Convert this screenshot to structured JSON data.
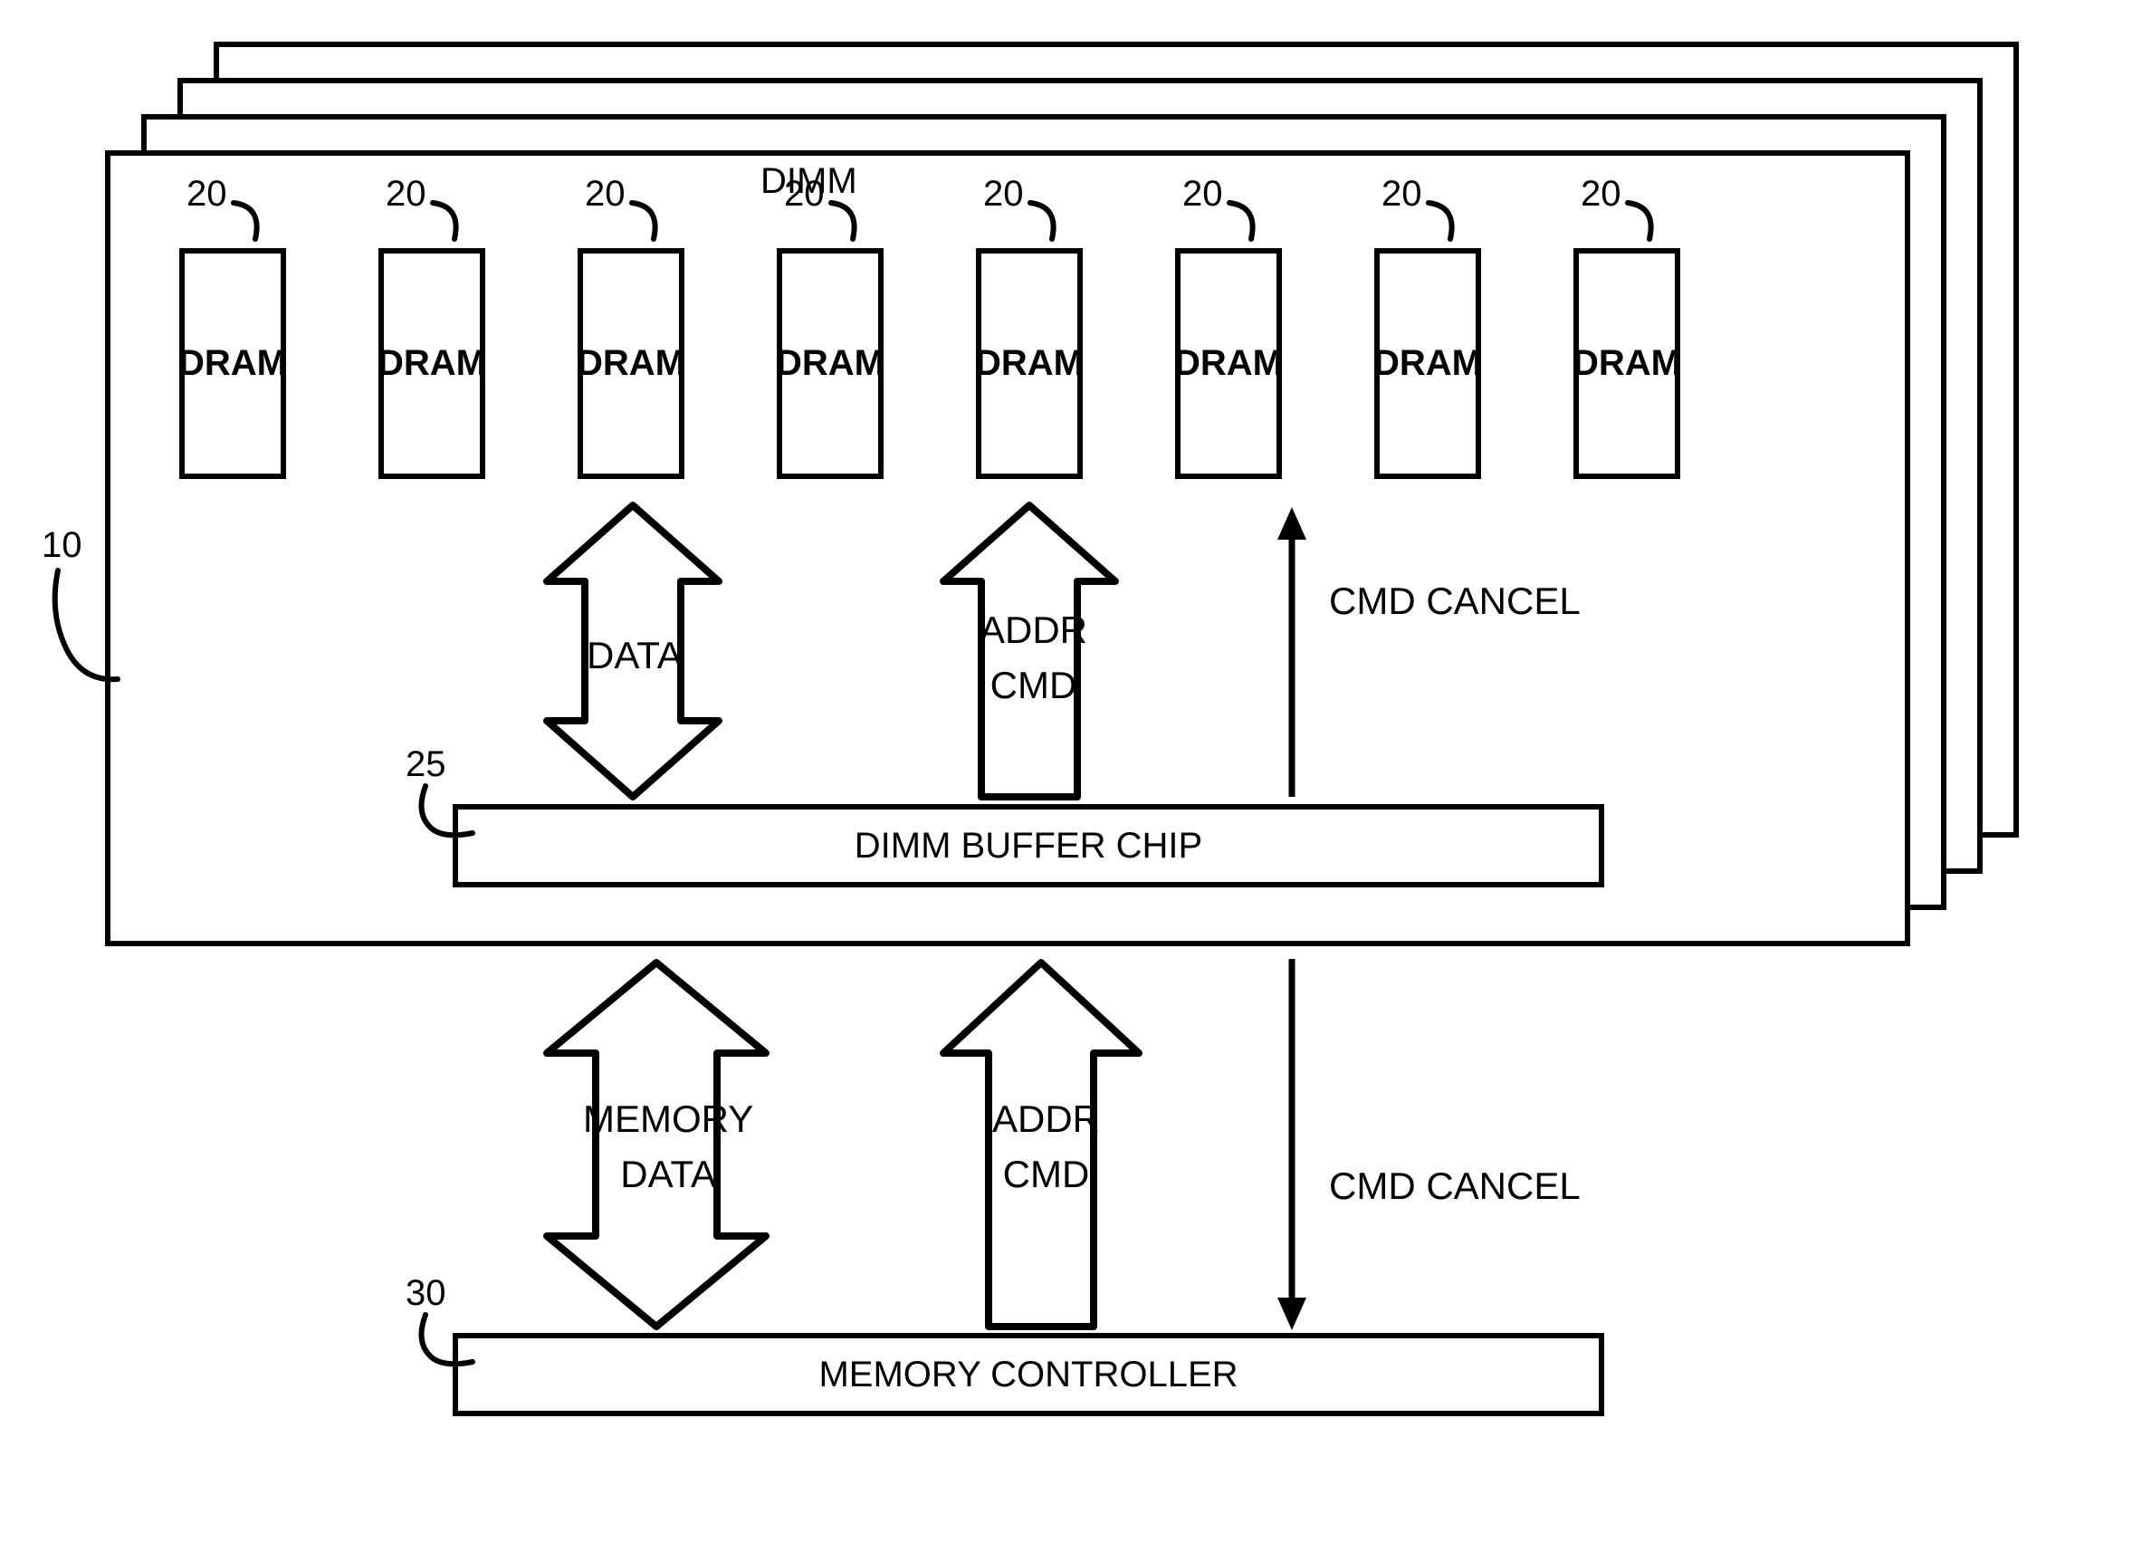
{
  "dimm": {
    "title": "DIMM",
    "ref_card": "10",
    "dram_label": "DRAM",
    "dram_ref": "20",
    "buffer": {
      "ref": "25",
      "label": "DIMM BUFFER CHIP"
    },
    "signals": {
      "data": "DATA",
      "addr_cmd": "ADDR\nCMD",
      "cmd_cancel": "CMD CANCEL"
    }
  },
  "external": {
    "memory_data": "MEMORY\nDATA",
    "addr_cmd": "ADDR\nCMD",
    "cmd_cancel": "CMD CANCEL"
  },
  "memory_controller": {
    "ref": "30",
    "label": "MEMORY CONTROLLER"
  }
}
